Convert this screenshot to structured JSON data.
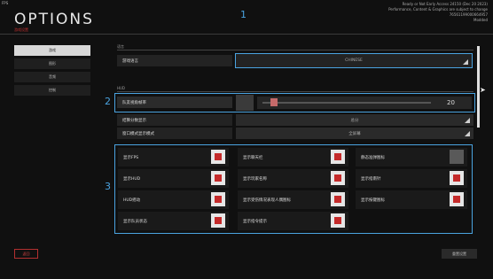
{
  "hud": {
    "fps_label": "FPS"
  },
  "header": {
    "title": "OPTIONS",
    "subtitle": "游戏设置",
    "build_lines": [
      "Ready or Not Early Access 24150 (Dec 20 2023)",
      "Performance, Content & Graphics are subject to change",
      "76561199000664957",
      "Modded"
    ]
  },
  "sidebar": {
    "items": [
      {
        "label": "游戏",
        "active": true
      },
      {
        "label": "图形",
        "active": false
      },
      {
        "label": "音频",
        "active": false
      },
      {
        "label": "控制",
        "active": false
      }
    ],
    "faint_labels": [
      "",
      "",
      "",
      "",
      "",
      "",
      ""
    ],
    "back_label": "返回"
  },
  "annotations": {
    "n1": "1",
    "n2": "2",
    "n3": "3"
  },
  "section_language": {
    "header": "语言",
    "label": "游戏语言",
    "value": "CHINESE"
  },
  "section_hud": {
    "header": "HUD",
    "fov_label": "队友视角帧率",
    "fov_value": "20",
    "fov_fraction": 0.07,
    "score_label": "结算分数显示",
    "score_value": "总分",
    "window_label": "窗口模式显示模式",
    "window_value": "全屏幕"
  },
  "toggles": [
    {
      "label": "显示FPS",
      "checked": true
    },
    {
      "label": "显示聊天栏",
      "checked": true
    },
    {
      "label": "静态准弹图标",
      "checked": false
    },
    {
      "label": "显示HUD",
      "checked": true
    },
    {
      "label": "显示玩家名称",
      "checked": true
    },
    {
      "label": "显示指南针",
      "checked": true
    },
    {
      "label": "HUD摇动",
      "checked": true
    },
    {
      "label": "显示受伤情况表现人偶图标",
      "checked": true
    },
    {
      "label": "显示按键图标",
      "checked": true
    },
    {
      "label": "显示队员状态",
      "checked": true
    },
    {
      "label": "显示指令提示",
      "checked": true
    }
  ],
  "footer": {
    "reset_label": "重置设置"
  },
  "colors": {
    "accent_blue": "#4aa3e0",
    "toggle_red": "#c42a2a",
    "back_red": "#b23030"
  }
}
